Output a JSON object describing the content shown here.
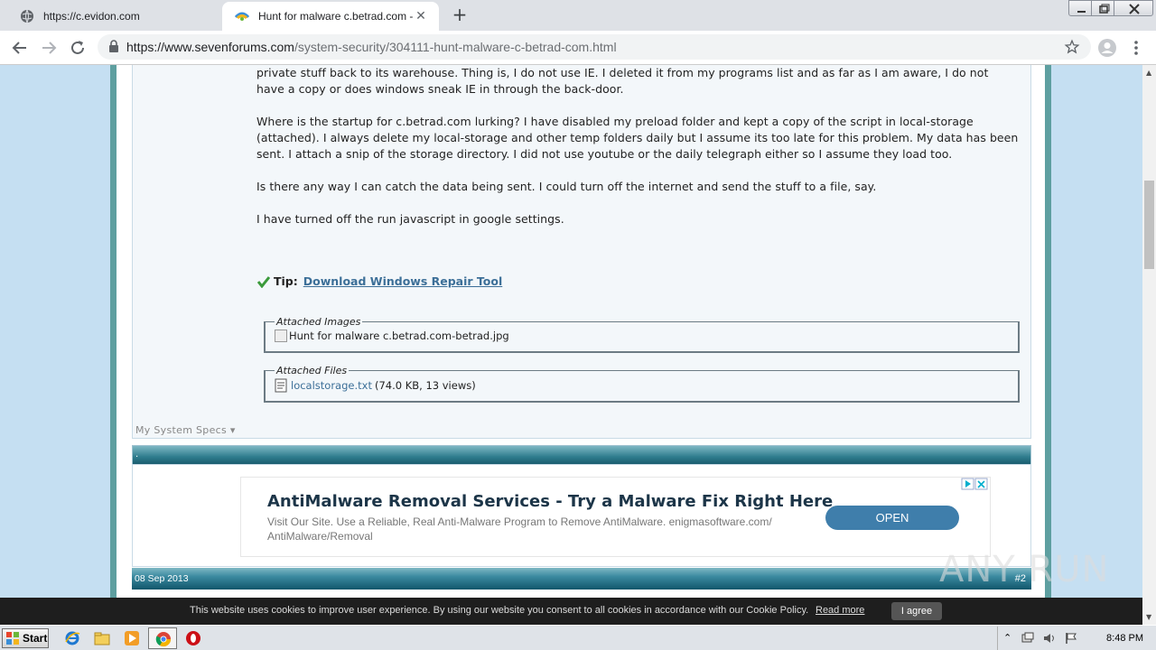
{
  "browser": {
    "tabs": [
      {
        "title": "https://c.evidon.com",
        "icon": "globe-icon"
      },
      {
        "title": "Hunt for malware c.betrad.com - Wi",
        "icon": "sevenforums-favicon"
      }
    ],
    "address": {
      "host": "https://www.sevenforums.com",
      "path": "/system-security/304111-hunt-malware-c-betrad-com.html"
    }
  },
  "post": {
    "paragraphs": [
      "private stuff back to its warehouse. Thing is, I do not use IE. I deleted it from my programs list and as far as I am aware, I do not have a copy or does windows sneak IE in through the back-door.",
      "Where is the startup for c.betrad.com lurking? I have disabled my preload folder and kept a copy of the script in local-storage (attached). I always delete my local-storage and other temp folders daily but I assume its too late for this problem. My data has been sent. I attach a snip of the storage directory. I did not use youtube or the daily telegraph either so I assume they load too.",
      "Is there any way I can catch the data being sent. I could turn off the internet and send the stuff to a file, say.",
      "I have turned off the run javascript in google settings."
    ],
    "tip_label": "Tip:",
    "tip_link": "Download Windows Repair Tool",
    "attached_images_legend": "Attached Images",
    "attached_image_alt": "Hunt for malware c.betrad.com-betrad.jpg",
    "attached_files_legend": "Attached Files",
    "attached_file_name": "localstorage.txt",
    "attached_file_meta": "(74.0 KB, 13 views)",
    "specs_label": "My System Specs"
  },
  "reply": {
    "head_dot": ".",
    "date": "08 Sep 2013",
    "post_number": "#2"
  },
  "ad": {
    "headline": "AntiMalware Removal Services - Try a Malware Fix Right Here",
    "description": "Visit Our Site. Use a Reliable, Real Anti-Malware Program to Remove AntiMalware. enigmasoftware.com/ AntiMalware/Removal",
    "button": "OPEN"
  },
  "cookie_banner": {
    "text": "This website uses cookies to improve user experience. By using our website you consent to all cookies in accordance with our Cookie Policy.",
    "read_more": "Read more",
    "agree": "I agree"
  },
  "watermark": "ANY RUN",
  "taskbar": {
    "start_label": "Start",
    "clock": "8:48 PM"
  },
  "colors": {
    "page_bg": "#c5dff2",
    "frame_teal": "#5e9fa0",
    "link_blue": "#3c6f98",
    "ad_button": "#3f7eab"
  }
}
